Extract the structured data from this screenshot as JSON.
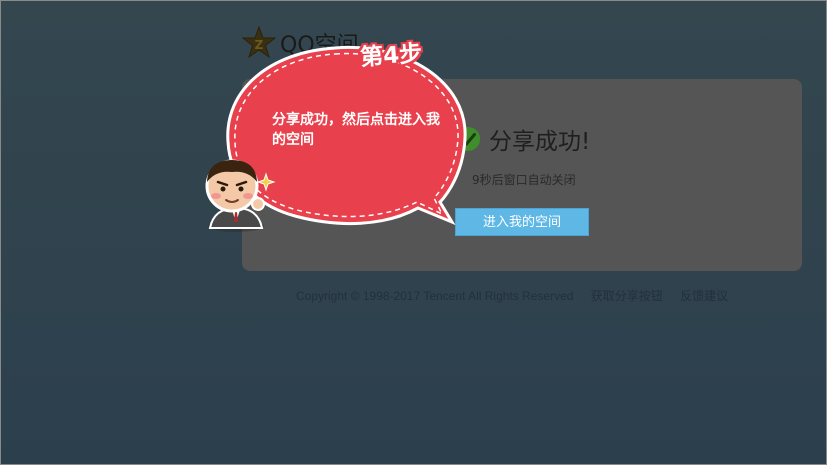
{
  "logo": {
    "text": "QQ空间",
    "icon": "star-logo-icon"
  },
  "panel": {
    "success_title": "分享成功!",
    "countdown": "9秒后窗口自动关闭",
    "enter_button": "进入我的空间"
  },
  "footer": {
    "copyright": "Copyright © 1998-2017 Tencent All Rights Reserved",
    "links": [
      "获取分享按钮",
      "反馈建议"
    ]
  },
  "tutorial": {
    "step": "第4步",
    "message": "分享成功，然后点击进入我的空间"
  },
  "colors": {
    "background": "#2f4350",
    "panel": "#555555",
    "button": "#5fb7e6",
    "bubble": "#e8404c",
    "check": "#3e8f2a"
  }
}
